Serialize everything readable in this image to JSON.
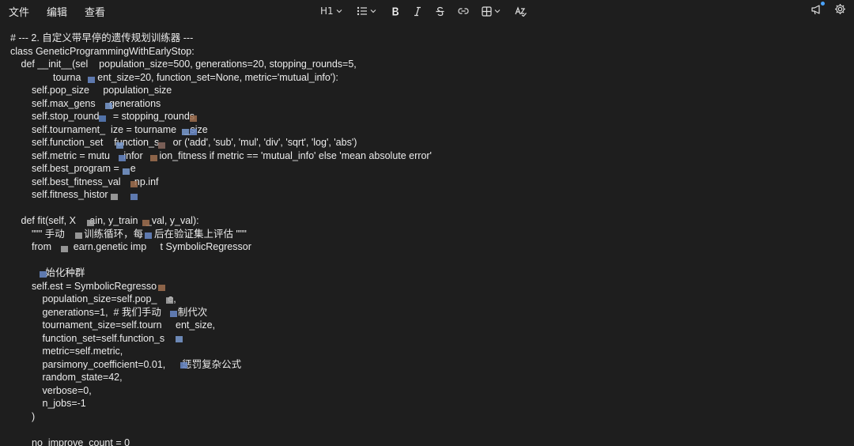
{
  "menubar": {
    "items": [
      "文件",
      "编辑",
      "查看"
    ]
  },
  "toolbar": {
    "heading_label": "H1",
    "icons": [
      "heading-icon",
      "bullet-list-icon",
      "bold-icon",
      "italic-icon",
      "strikethrough-icon",
      "link-icon",
      "table-icon",
      "spellcheck-icon"
    ]
  },
  "editor": {
    "lines": [
      {
        "indent": 0,
        "text": "# --- 2. 自定义带早停的遗传规划训练器 ---"
      },
      {
        "indent": 0,
        "text": "class GeneticProgrammingWithEarlyStop:"
      },
      {
        "indent": 1,
        "text": "def __init__(sel    population_size=500, generations=20, stopping_rounds=5,"
      },
      {
        "indent": 4,
        "text": "tourna      ent_size=20, function_set=None, metric='mutual_info'):"
      },
      {
        "indent": 2,
        "text": "self.pop_size     population_size"
      },
      {
        "indent": 2,
        "text": "self.max_gens     generations"
      },
      {
        "indent": 2,
        "text": "self.stop_round     = stopping_rounds"
      },
      {
        "indent": 2,
        "text": "self.tournament_  ize = tourname   _size"
      },
      {
        "indent": 2,
        "text": "self.function_set    function_s     or ('add', 'sub', 'mul', 'div', 'sqrt', 'log', 'abs')"
      },
      {
        "indent": 2,
        "text": "self.metric = mutu     infor      ion_fitness if metric == 'mutual_info' else 'mean absolute error'"
      },
      {
        "indent": 2,
        "text": "self.best_program =    e"
      },
      {
        "indent": 2,
        "text": "self.best_fitness_val     np.inf"
      },
      {
        "indent": 2,
        "text": "self.fitness_histor"
      },
      {
        "indent": 0,
        "text": ""
      },
      {
        "indent": 1,
        "text": "def fit(self, X     ain, y_train   _val, y_val):"
      },
      {
        "indent": 2,
        "text": "\"\"\" 手动       训练循环，每    后在验证集上评估 \"\"\""
      },
      {
        "indent": 2,
        "text": "from        earn.genetic imp     t SymbolicRegressor"
      },
      {
        "indent": 0,
        "text": ""
      },
      {
        "indent": 2,
        "text": "     始化种群"
      },
      {
        "indent": 2,
        "text": "self.est = SymbolicRegresso"
      },
      {
        "indent": 3,
        "text": "population_size=self.pop_    e,"
      },
      {
        "indent": 3,
        "text": "generations=1,  # 我们手动      制代次"
      },
      {
        "indent": 3,
        "text": "tournament_size=self.tourn     ent_size,"
      },
      {
        "indent": 3,
        "text": "function_set=self.function_s"
      },
      {
        "indent": 3,
        "text": "metric=self.metric,"
      },
      {
        "indent": 3,
        "text": "parsimony_coefficient=0.01,      惩罚复杂公式"
      },
      {
        "indent": 3,
        "text": "random_state=42,"
      },
      {
        "indent": 3,
        "text": "verbose=0,"
      },
      {
        "indent": 3,
        "text": "n_jobs=-1"
      },
      {
        "indent": 2,
        "text": ")"
      },
      {
        "indent": 0,
        "text": ""
      },
      {
        "indent": 2,
        "text": "no_improve_count = 0"
      }
    ]
  }
}
